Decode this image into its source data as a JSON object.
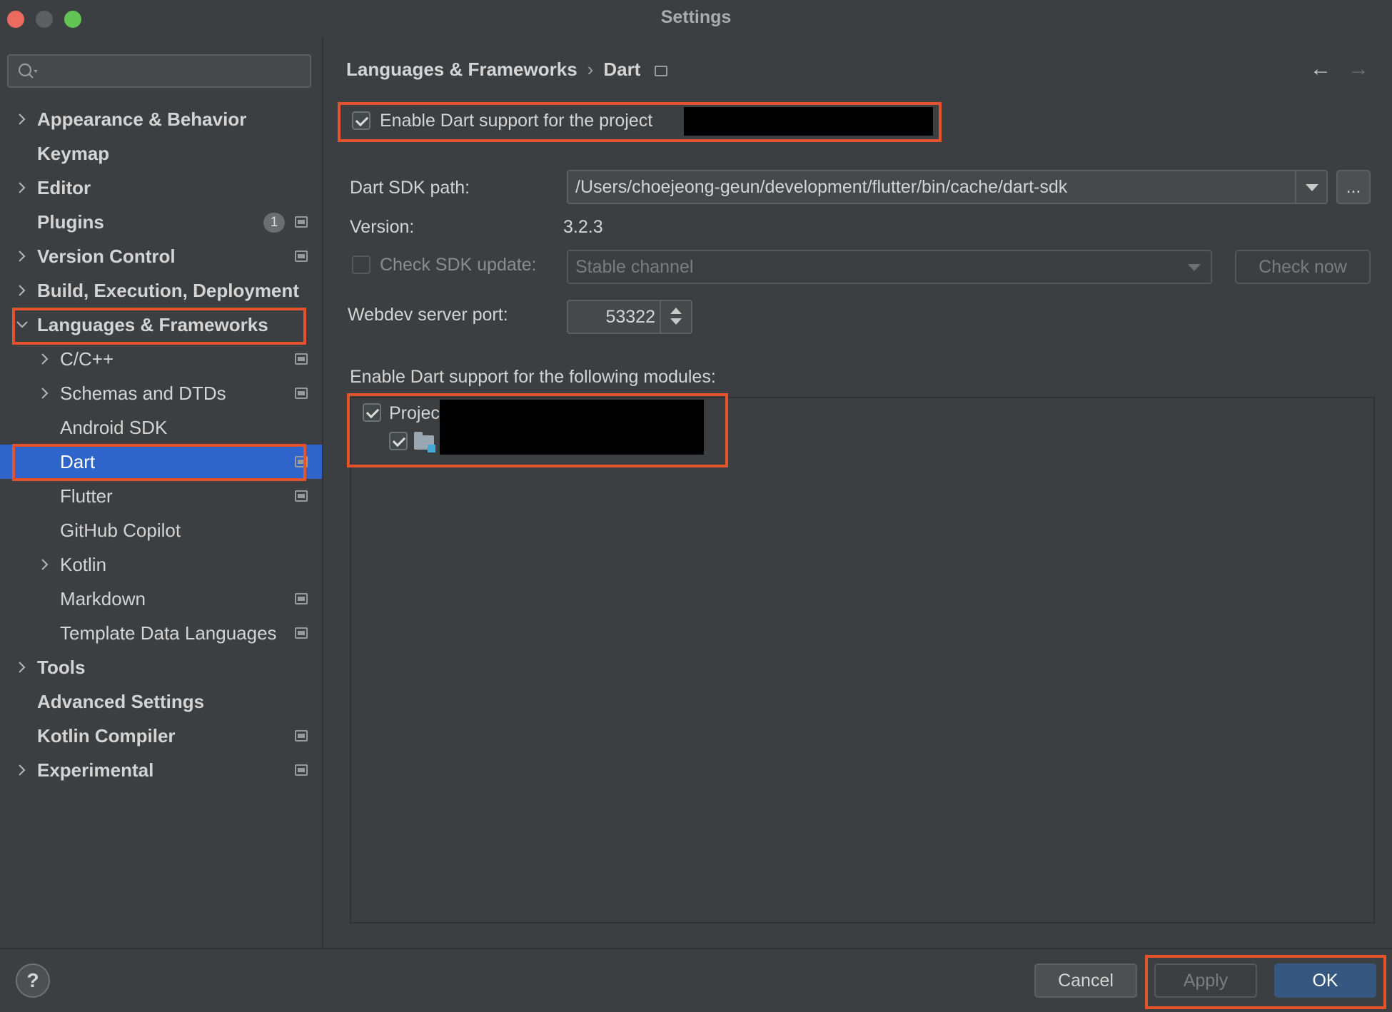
{
  "window": {
    "title": "Settings"
  },
  "search": {
    "placeholder": ""
  },
  "sidebar": {
    "items": [
      {
        "label": "Appearance & Behavior"
      },
      {
        "label": "Keymap"
      },
      {
        "label": "Editor"
      },
      {
        "label": "Plugins",
        "badge": "1"
      },
      {
        "label": "Version Control"
      },
      {
        "label": "Build, Execution, Deployment"
      },
      {
        "label": "Languages & Frameworks"
      },
      {
        "label": "C/C++"
      },
      {
        "label": "Schemas and DTDs"
      },
      {
        "label": "Android SDK"
      },
      {
        "label": "Dart"
      },
      {
        "label": "Flutter"
      },
      {
        "label": "GitHub Copilot"
      },
      {
        "label": "Kotlin"
      },
      {
        "label": "Markdown"
      },
      {
        "label": "Template Data Languages"
      },
      {
        "label": "Tools"
      },
      {
        "label": "Advanced Settings"
      },
      {
        "label": "Kotlin Compiler"
      },
      {
        "label": "Experimental"
      }
    ]
  },
  "breadcrumb": {
    "parent": "Languages & Frameworks",
    "sep": "›",
    "current": "Dart"
  },
  "nav": {
    "back": "←",
    "forward": "→"
  },
  "dart": {
    "enable_label": "Enable Dart support for the project",
    "sdk_path_label": "Dart SDK path:",
    "sdk_path_value": "/Users/choejeong-geun/development/flutter/bin/cache/dart-sdk",
    "browse_label": "...",
    "version_label": "Version:",
    "version_value": "3.2.3",
    "check_update_label": "Check SDK update:",
    "channel_value": "Stable channel",
    "check_now_label": "Check now",
    "webdev_label": "Webdev server port:",
    "webdev_value": "53322",
    "modules_label": "Enable Dart support for the following modules:",
    "modules_project_label": "Projec"
  },
  "footer": {
    "help": "?",
    "cancel": "Cancel",
    "apply": "Apply",
    "ok": "OK"
  },
  "colors": {
    "accent": "#2f65ca",
    "highlight": "#e5532d",
    "primary_button": "#365880"
  }
}
